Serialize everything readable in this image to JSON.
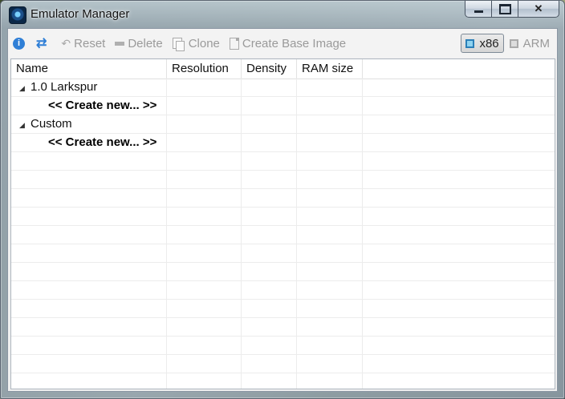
{
  "window": {
    "title": "Emulator Manager",
    "buttons": {
      "minimize": "minimize",
      "maximize": "maximize",
      "close": "✕"
    }
  },
  "toolbar": {
    "info_icon": "i",
    "refresh_icon": "⇄",
    "reset_label": "Reset",
    "delete_label": "Delete",
    "clone_label": "Clone",
    "create_base_label": "Create Base Image",
    "arch": {
      "x86_label": "x86",
      "arm_label": "ARM",
      "selected": "x86"
    }
  },
  "table": {
    "columns": [
      "Name",
      "Resolution",
      "Density",
      "RAM size"
    ],
    "groups": [
      {
        "expander": "◢",
        "label": "1.0 Larkspur",
        "create_label": "<< Create new... >>"
      },
      {
        "expander": "◢",
        "label": "Custom",
        "create_label": "<< Create new... >>"
      }
    ]
  },
  "colors": {
    "accent": "#2f7fd6",
    "disabled_text": "#9a9a9a"
  }
}
